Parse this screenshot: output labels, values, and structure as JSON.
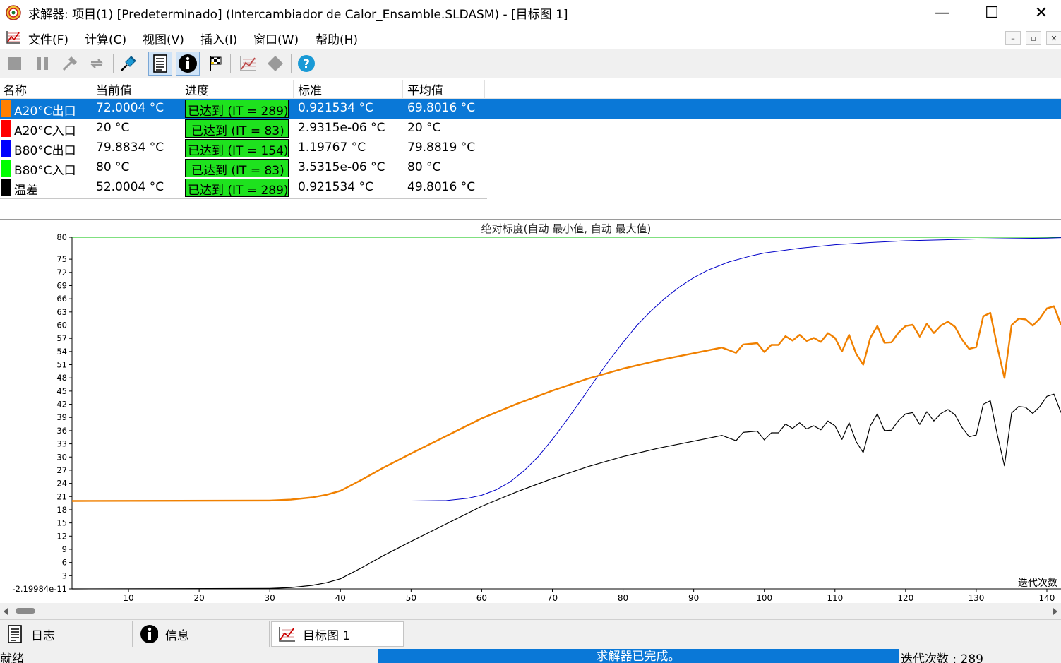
{
  "window": {
    "title": "求解器: 项目(1) [Predeterminado] (Intercambiador de Calor_Ensamble.SLDASM) - [目标图 1]",
    "app_icon": "solver-app-icon",
    "minimize_label": "—",
    "maximize_label": "☐",
    "close_label": "✕"
  },
  "menu": {
    "items": [
      "文件(F)",
      "计算(C)",
      "视图(V)",
      "插入(I)",
      "窗口(W)",
      "帮助(H)"
    ],
    "mdi_min": "–",
    "mdi_restore": "▫",
    "mdi_close": "✕"
  },
  "toolbar": {
    "buttons": [
      {
        "name": "stop-icon",
        "enabled": false
      },
      {
        "name": "pause-icon",
        "enabled": false
      },
      {
        "name": "insert-icon",
        "enabled": false
      },
      {
        "name": "refresh-icon",
        "enabled": false
      },
      {
        "name": "pin-icon",
        "enabled": true
      },
      {
        "name": "log-icon",
        "enabled": true,
        "pressed": true
      },
      {
        "name": "info-icon",
        "enabled": true,
        "pressed": true
      },
      {
        "name": "goals-flag-icon",
        "enabled": true
      },
      {
        "name": "insert-plot-icon",
        "enabled": false
      },
      {
        "name": "diamond-icon",
        "enabled": false
      },
      {
        "name": "help-icon",
        "enabled": true
      }
    ]
  },
  "goals": {
    "columns": [
      "名称",
      "当前值",
      "进度",
      "标准",
      "平均值"
    ],
    "rows": [
      {
        "color": "#ff8000",
        "name": "A20°C出口",
        "current": "72.0004 °C",
        "progress": "已达到 (IT = 289)",
        "criterion": "0.921534 °C",
        "average": "69.8016 °C",
        "selected": true
      },
      {
        "color": "#ff0000",
        "name": "A20°C入口",
        "current": "20 °C",
        "progress": "已达到 (IT = 83)",
        "criterion": "2.9315e-06 °C",
        "average": "20 °C",
        "selected": false
      },
      {
        "color": "#0000ff",
        "name": "B80°C出口",
        "current": "79.8834 °C",
        "progress": "已达到 (IT = 154)",
        "criterion": "1.19767 °C",
        "average": "79.8819 °C",
        "selected": false
      },
      {
        "color": "#00ff00",
        "name": "B80°C入口",
        "current": "80 °C",
        "progress": "已达到 (IT = 83)",
        "criterion": "3.5315e-06 °C",
        "average": "80 °C",
        "selected": false
      },
      {
        "color": "#000000",
        "name": "温差",
        "current": "52.0004 °C",
        "progress": "已达到 (IT = 289)",
        "criterion": "0.921534 °C",
        "average": "49.8016 °C",
        "selected": false
      }
    ]
  },
  "chart_data": {
    "type": "line",
    "title": "绝对标度(自动  最小值, 自动  最大值)",
    "xlabel": "迭代次数",
    "ylabel": "",
    "xlim": [
      2,
      142
    ],
    "ylim": [
      -2.19984e-11,
      80
    ],
    "x_ticks": [
      "10",
      "20",
      "30",
      "40",
      "50",
      "60",
      "70",
      "80",
      "90",
      "100",
      "110",
      "120",
      "130",
      "140"
    ],
    "y_ticks": [
      "-2.19984e-11",
      "3",
      "6",
      "9",
      "12",
      "15",
      "18",
      "21",
      "24",
      "27",
      "30",
      "33",
      "36",
      "39",
      "42",
      "45",
      "48",
      "51",
      "54",
      "57",
      "60",
      "63",
      "66",
      "69",
      "72",
      "75",
      "80"
    ],
    "series": [
      {
        "name": "B80°C入口",
        "color": "#00c000",
        "width": 1,
        "x": [
          2,
          142
        ],
        "y": [
          80,
          80
        ]
      },
      {
        "name": "A20°C入口",
        "color": "#e00000",
        "width": 1,
        "x": [
          2,
          142
        ],
        "y": [
          20,
          20
        ]
      },
      {
        "name": "B80°C出口",
        "color": "#0000c8",
        "width": 1,
        "x": [
          2,
          50,
          55,
          58,
          60,
          62,
          64,
          66,
          68,
          70,
          72,
          74,
          76,
          78,
          80,
          82,
          84,
          86,
          88,
          90,
          92,
          95,
          98,
          100,
          105,
          110,
          115,
          120,
          125,
          130,
          135,
          140,
          142
        ],
        "y": [
          20,
          20,
          20.1,
          20.6,
          21.3,
          22.5,
          24.3,
          26.9,
          30.1,
          34,
          38.3,
          42.8,
          47.4,
          51.9,
          56.1,
          60,
          63.3,
          66.2,
          68.7,
          70.8,
          72.5,
          74.4,
          75.7,
          76.4,
          77.5,
          78.3,
          78.8,
          79.2,
          79.4,
          79.6,
          79.7,
          79.8,
          79.9
        ]
      },
      {
        "name": "A20°C出口",
        "color": "#f08000",
        "width": 2.4,
        "x": [
          2,
          30,
          33,
          36,
          38,
          40,
          43,
          46,
          50,
          55,
          60,
          65,
          70,
          75,
          80,
          85,
          90,
          94,
          96,
          97,
          99,
          100,
          101,
          102,
          103,
          104,
          105,
          106,
          107,
          108,
          109,
          110,
          111,
          112,
          113,
          114,
          115,
          116,
          117,
          118,
          119,
          120,
          121,
          122,
          123,
          124,
          125,
          126,
          127,
          128,
          129,
          130,
          131,
          132,
          133,
          134,
          135,
          136,
          137,
          138,
          139,
          140,
          141,
          142
        ],
        "y": [
          20,
          20.1,
          20.3,
          20.8,
          21.4,
          22.3,
          24.8,
          27.5,
          30.8,
          34.8,
          38.8,
          42.1,
          45.1,
          47.8,
          50.1,
          52,
          53.6,
          54.9,
          53.7,
          55.6,
          55.9,
          53.9,
          55.5,
          55.5,
          57.5,
          56.5,
          57.8,
          56.4,
          57.1,
          56.2,
          58.2,
          57.1,
          54,
          57.8,
          53.5,
          51,
          57.1,
          59.8,
          56,
          56.1,
          58.3,
          59.8,
          60.1,
          57.4,
          60.3,
          58.2,
          59.9,
          60.8,
          59.6,
          56.7,
          54.6,
          55,
          62,
          62.8,
          55,
          48,
          60,
          61.5,
          61.3,
          59.9,
          61.5,
          63.8,
          64.3,
          60.1
        ]
      },
      {
        "name": "温差",
        "color": "#000000",
        "width": 1.2,
        "x": [
          2,
          30,
          33,
          36,
          38,
          40,
          43,
          46,
          50,
          55,
          60,
          65,
          70,
          75,
          80,
          85,
          90,
          94,
          96,
          97,
          99,
          100,
          101,
          102,
          103,
          104,
          105,
          106,
          107,
          108,
          109,
          110,
          111,
          112,
          113,
          114,
          115,
          116,
          117,
          118,
          119,
          120,
          121,
          122,
          123,
          124,
          125,
          126,
          127,
          128,
          129,
          130,
          131,
          132,
          133,
          134,
          135,
          136,
          137,
          138,
          139,
          140,
          141,
          142
        ],
        "y": [
          0,
          0.1,
          0.3,
          0.8,
          1.4,
          2.3,
          4.8,
          7.5,
          10.8,
          14.8,
          18.8,
          22.1,
          25.1,
          27.8,
          30.1,
          32,
          33.6,
          34.9,
          33.7,
          35.6,
          35.9,
          33.9,
          35.5,
          35.5,
          37.5,
          36.5,
          37.8,
          36.4,
          37.1,
          36.2,
          38.2,
          37.1,
          34,
          37.8,
          33.5,
          31,
          37.1,
          39.8,
          36,
          36.1,
          38.3,
          39.8,
          40.1,
          37.4,
          40.3,
          38.2,
          39.9,
          40.8,
          39.6,
          36.7,
          34.6,
          35,
          42,
          42.8,
          35,
          28,
          40,
          41.5,
          41.3,
          39.9,
          41.5,
          43.8,
          44.3,
          40.1
        ]
      }
    ]
  },
  "tabs": [
    {
      "label": "日志",
      "icon": "log-icon",
      "active": false
    },
    {
      "label": "信息",
      "icon": "info-icon",
      "active": false
    },
    {
      "label": "目标图 1",
      "icon": "goal-plot-icon",
      "active": true
    }
  ],
  "status": {
    "ready": "就绪",
    "progress_text": "求解器已完成。",
    "progress_fraction": 1.0,
    "iterations": "迭代次数 : 289"
  }
}
